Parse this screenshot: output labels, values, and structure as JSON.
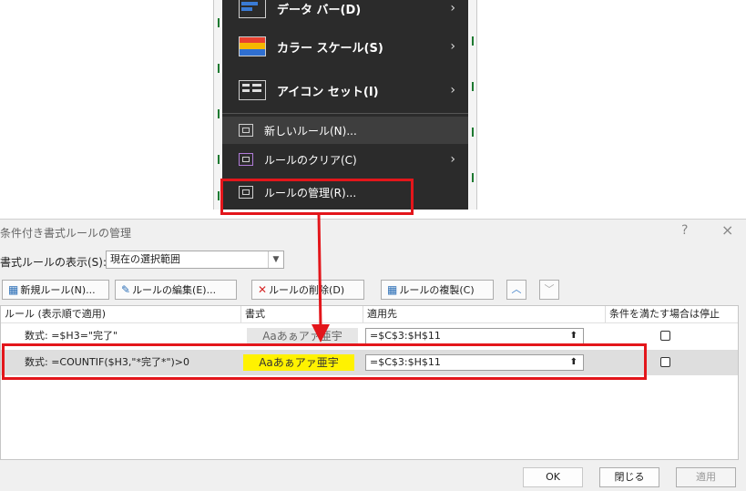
{
  "menu": {
    "items": [
      {
        "label": "データ バー(D)",
        "has_submenu": true
      },
      {
        "label": "カラー スケール(S)",
        "has_submenu": true
      },
      {
        "label": "アイコン セット(I)",
        "has_submenu": true
      },
      {
        "label": "新しいルール(N)...",
        "has_submenu": false
      },
      {
        "label": "ルールのクリア(C)",
        "has_submenu": true
      },
      {
        "label": "ルールの管理(R)...",
        "has_submenu": false
      }
    ]
  },
  "dialog": {
    "title": "条件付き書式ルールの管理",
    "help_glyph": "?",
    "close_glyph": "×",
    "scope_label": "書式ルールの表示(S):",
    "scope_value": "現在の選択範囲",
    "toolbar": {
      "new_rule": "新規ルール(N)...",
      "edit_rule": "ルールの編集(E)...",
      "delete_rule": "ルールの削除(D)",
      "duplicate_rule": "ルールの複製(C)"
    },
    "columns": {
      "rule": "ルール (表示順で適用)",
      "format": "書式",
      "applies_to": "適用先",
      "stop_if_true": "条件を満たす場合は停止"
    },
    "rules": [
      {
        "rule": "数式: =$H3=\"完了\"",
        "format_preview": "Aaあぁアァ亜宇",
        "applies_to": "=$C$3:$H$11",
        "stop_if_true": false,
        "format_bg": "#e6e6e6"
      },
      {
        "rule": "数式: =COUNTIF($H3,\"*完了*\")>0",
        "format_preview": "Aaあぁアァ亜宇",
        "applies_to": "=$C$3:$H$11",
        "stop_if_true": false,
        "format_bg": "#fff200"
      }
    ],
    "buttons": {
      "ok": "OK",
      "close": "閉じる",
      "apply": "適用"
    }
  },
  "colors": {
    "highlight": "#e3161b",
    "menu_bg": "#2b2b2b",
    "yellow_format": "#fff200"
  }
}
